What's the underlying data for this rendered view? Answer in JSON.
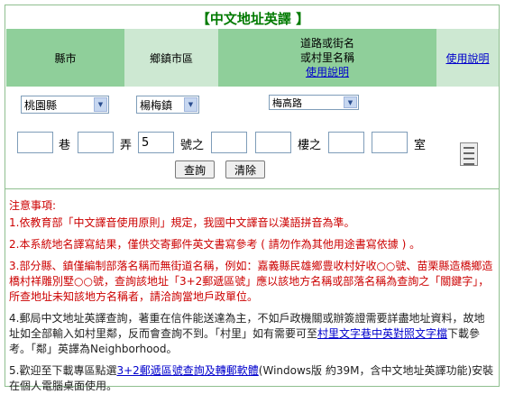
{
  "title": "【中文地址英譯 】",
  "header": {
    "county": "縣市",
    "town": "鄉鎮市區",
    "road_line1": "道路或街名",
    "road_line2": "或村里名稱",
    "road_help": "使用說明",
    "help": "使用說明"
  },
  "selects": {
    "county": "桃園縣",
    "town": "楊梅鎮",
    "road": "梅高路"
  },
  "address": {
    "lane_value": "",
    "lane_label": "巷",
    "alley_value": "",
    "alley_label": "弄",
    "number_value": "5",
    "number_label": "號之",
    "sub1_value": "",
    "sub2_value": "",
    "floor_label": "樓之",
    "floor1_value": "",
    "floor2_value": "",
    "room_label": "室"
  },
  "buttons": {
    "query": "查詢",
    "clear": "清除"
  },
  "notes": {
    "heading": "注意事項:",
    "n1": "1.依教育部「中文譯音使用原則」規定，我國中文譯音以漢語拼音為準。",
    "n2": "2.本系統地名譯寫結果，僅供交寄郵件英文書寫參考 ( 請勿作為其他用途書寫依據 ) 。",
    "n3": "3.部分縣、鎮僅編制部落名稱而無街道名稱，例如：嘉義縣民雄鄉豊收村好收○○號、苗栗縣造橋鄉造橋村祥雕別墅○○號，查詢該地址「3+2郵遞區號」應以該地方名稱或部落名稱為查詢之「關鍵字」，所查地址未知該地方名稱者，請洽詢當地戶政單位。",
    "n4_a": "4.郵局中文地址英譯查詢，著重在信件能送達為主，不如戶政機關或辦簽證需要詳盡地址資料，故地址如全部輸入如村里鄰，反而會查詢不到。「村里」如有需要可至",
    "n4_link": "村里文字巷中英對照文字檔",
    "n4_b": "下載參考。「鄰」英譯為Neighborhood。",
    "n5_a": "5.歡迎至下載專區點選",
    "n5_link": "3+2郵遞區號查詢及轉郵軟體",
    "n5_b": "(Windows版 約39M，含中文地址英譯功能)安裝在個人電腦桌面使用。"
  }
}
